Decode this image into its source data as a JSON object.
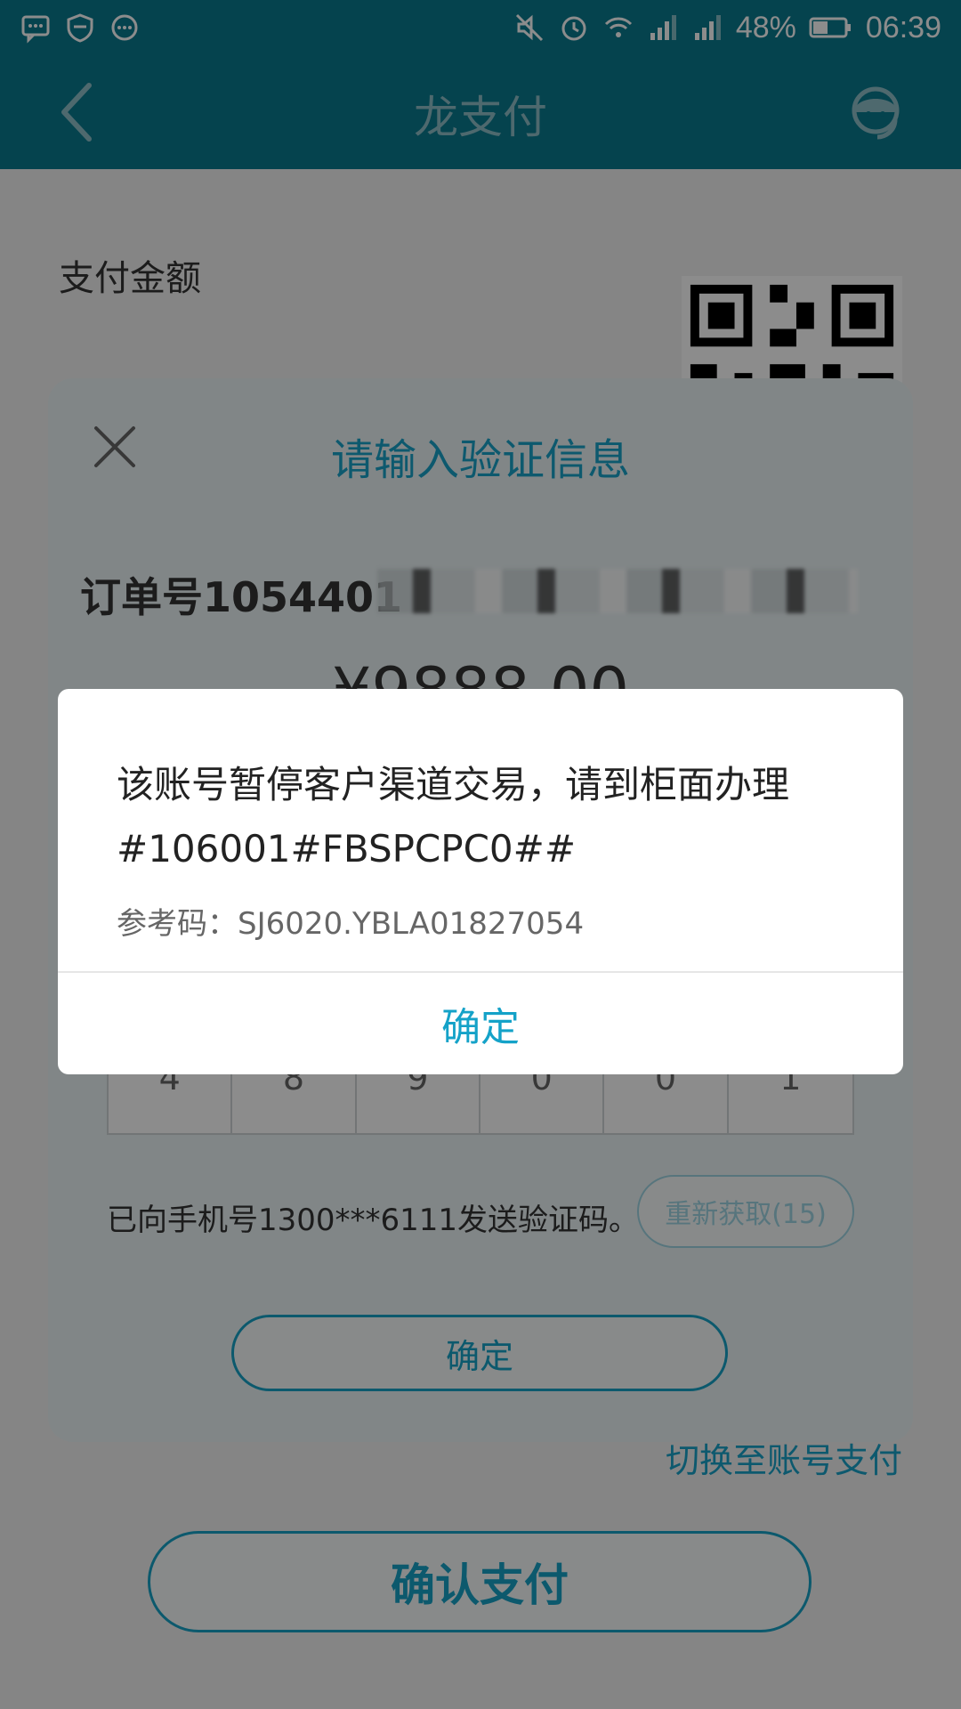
{
  "status_bar": {
    "battery_percent": "48%",
    "time": "06:39"
  },
  "header": {
    "title": "龙支付"
  },
  "page": {
    "pay_amount_label": "支付金额",
    "switch_link": "切换至账号支付",
    "confirm_pay_button": "确认支付"
  },
  "verify_modal": {
    "title": "请输入验证信息",
    "order_label": "订单号1054401",
    "amount": "¥9888.00",
    "code_digits": [
      "4",
      "8",
      "9",
      "0",
      "0",
      "1"
    ],
    "sms_notice": "已向手机号1300***6111发送验证码。",
    "resend_button": "重新获取(15)",
    "confirm_button": "确定"
  },
  "alert": {
    "message": "该账号暂停客户渠道交易，请到柜面办理#106001#FBSPCPC0##",
    "reference": "参考码：SJ6020.YBLA01827054",
    "ok_button": "确定"
  },
  "icons": {
    "back": "chevron-left-icon",
    "service": "customer-service-icon",
    "close": "close-icon",
    "qr": "qr-code-icon"
  },
  "colors": {
    "primary": "#0a7a8f",
    "accent": "#16a3c6"
  }
}
